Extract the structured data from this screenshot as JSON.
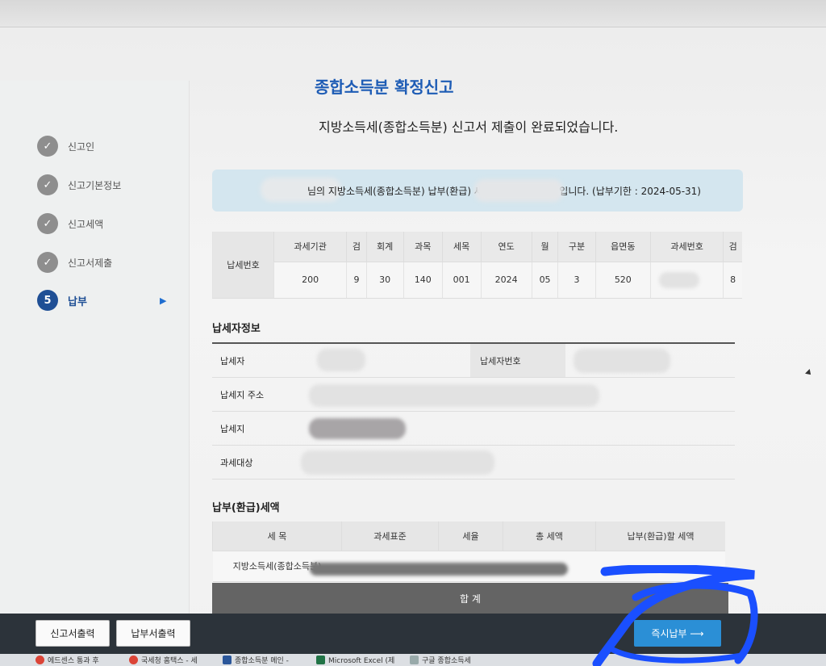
{
  "sidebar": {
    "steps": [
      {
        "label": "신고인",
        "done": true
      },
      {
        "label": "신고기본정보",
        "done": true
      },
      {
        "label": "신고세액",
        "done": true
      },
      {
        "label": "신고서제출",
        "done": true
      },
      {
        "label": "납부",
        "number": "5",
        "active": true
      }
    ]
  },
  "page": {
    "title": "종합소득분 확정신고",
    "subtitle": "지방소득세(종합소득분) 신고서 제출이 완료되었습니다.",
    "notice_prefix": "님의 지방소득세(종합소득분) 납부(환급) 세",
    "notice_suffix": "원 입니다. (납부기한 : 2024-05-31)"
  },
  "tax_number": {
    "row_label": "납세번호",
    "headers": [
      "과세기관",
      "검",
      "회계",
      "과목",
      "세목",
      "연도",
      "월",
      "구분",
      "읍면동",
      "과세번호",
      "검"
    ],
    "values": [
      "200",
      "9",
      "30",
      "140",
      "001",
      "2024",
      "05",
      "3",
      "520",
      "",
      "8"
    ]
  },
  "payer_info": {
    "heading": "납세자정보",
    "taxpayer_label": "납세자",
    "taxpayer_no_label": "납세자번호",
    "address_label": "납세지 주소",
    "location_label": "납세지",
    "target_label": "과세대상"
  },
  "refund": {
    "heading": "납부(환급)세액",
    "headers": [
      "세 목",
      "과세표준",
      "세율",
      "총 세액",
      "납부(환급)할 세액"
    ],
    "row_name": "지방소득세(종합소득분)",
    "sum_label": "합 계"
  },
  "actions": {
    "print_report": "신고서출력",
    "print_payment": "납부서출력",
    "pay_now": "즉시납부 ⟶"
  },
  "taskbar": {
    "items": [
      "에드센스 통과 후",
      "국세청 홈택스 - 세",
      "종합소득분 메인 -",
      "Microsoft Excel (제",
      "구글 종합소득세"
    ]
  },
  "colors": {
    "title_blue": "#1e5cb5",
    "active_step": "#1f4f95",
    "pay_button": "#2b8fd6",
    "marker": "#1a4fff"
  }
}
